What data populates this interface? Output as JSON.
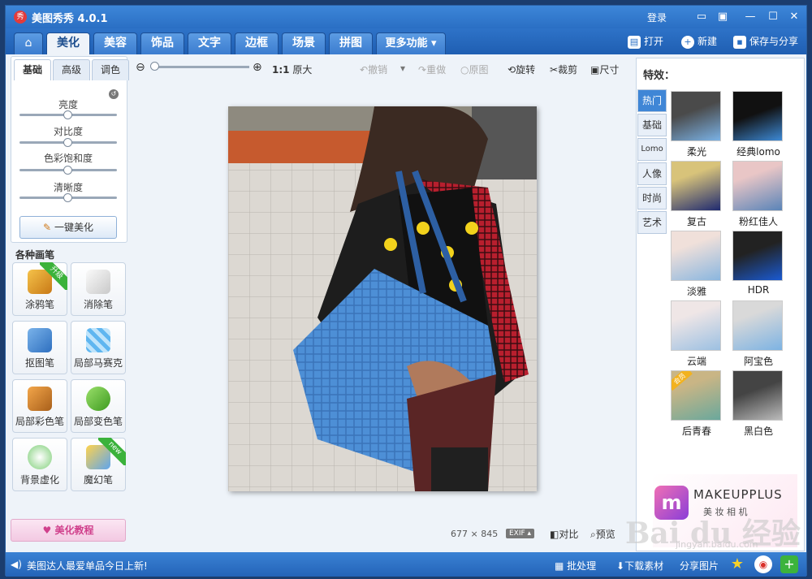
{
  "app": {
    "title": "美图秀秀 4.0.1",
    "logo_text": "秀"
  },
  "titlebar": {
    "login": "登录"
  },
  "nav": {
    "tabs": [
      "美化",
      "美容",
      "饰品",
      "文字",
      "边框",
      "场景",
      "拼图",
      "更多功能"
    ],
    "active_tab": "美化",
    "open": "打开",
    "new": "新建",
    "save_share": "保存与分享"
  },
  "left": {
    "subtabs": [
      "基础",
      "高级",
      "调色"
    ],
    "sliders": [
      "亮度",
      "对比度",
      "色彩饱和度",
      "清晰度"
    ],
    "one_click": "一键美化",
    "brushes_title": "各种画笔",
    "tools": [
      {
        "label": "涂鸦笔",
        "badge": "升级"
      },
      {
        "label": "消除笔",
        "badge": ""
      },
      {
        "label": "抠图笔",
        "badge": ""
      },
      {
        "label": "局部马赛克",
        "badge": ""
      },
      {
        "label": "局部彩色笔",
        "badge": ""
      },
      {
        "label": "局部变色笔",
        "badge": ""
      },
      {
        "label": "背景虚化",
        "badge": ""
      },
      {
        "label": "魔幻笔",
        "badge": "new"
      }
    ],
    "tutorial": "美化教程"
  },
  "toolbar": {
    "ratio": "1:1",
    "original_size": "原大",
    "undo": "撤销",
    "redo": "重做",
    "original": "原图",
    "rotate": "旋转",
    "crop": "裁剪",
    "resize": "尺寸"
  },
  "status": {
    "width": "677",
    "times": "×",
    "height": "845",
    "exif": "EXIF",
    "compare": "对比",
    "preview": "预览"
  },
  "effects": {
    "title": "特效：",
    "categories": [
      "热门",
      "基础",
      "Lomo",
      "人像",
      "时尚",
      "艺术"
    ],
    "active_category": "热门",
    "items": [
      "柔光",
      "经典lomo",
      "复古",
      "粉红佳人",
      "淡雅",
      "HDR",
      "云端",
      "阿宝色",
      "后青春",
      "黑白色"
    ],
    "ad_brand": "MAKEUPPLUS",
    "ad_sub": "美 妆 相 机",
    "ad_badge": "会员"
  },
  "bottom": {
    "news": "美图达人最爱单品今日上新!",
    "batch": "批处理",
    "download": "下载素材",
    "share": "分享图片"
  },
  "watermark": {
    "text": "Bai du 经验",
    "url": "jingyan.baidu.com"
  },
  "colors": {
    "accent": "#2a6fc4",
    "active_effect_tab": "#3f86d6",
    "tutorial": "#d0408c"
  }
}
